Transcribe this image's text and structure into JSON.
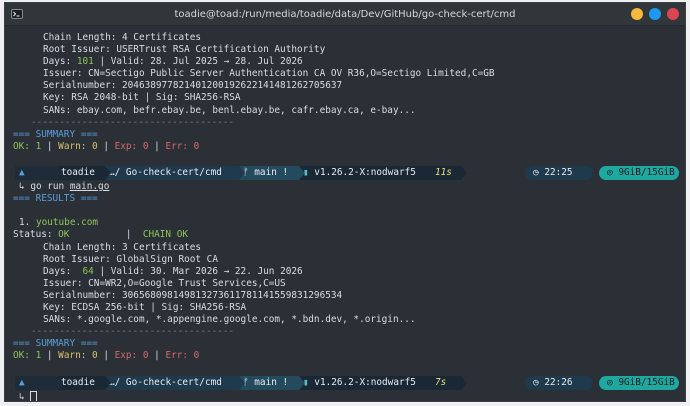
{
  "window": {
    "title": "toadie@toad:/run/media/toadie/data/Dev/GitHub/go-check-cert/cmd",
    "colors": {
      "close": "#da4453",
      "maximize": "#1d99f3",
      "minimize": "#f6b93b"
    }
  },
  "block1": {
    "chain_length": "Chain Length: 4 Certificates",
    "root_issuer": "Root Issuer: USERTrust RSA Certification Authority",
    "days_label": "Days: ",
    "days_value": "101",
    "days_rest": " | Valid: 28. Jul 2025 → 28. Jul 2026",
    "issuer": "Issuer: CN=Sectigo Public Server Authentication CA OV R36,O=Sectigo Limited,C=GB",
    "serial": "Serialnumber: 204638977821401200192622141481262705637",
    "key": "Key: RSA 2048-bit | Sig: SHA256-RSA",
    "sans": "SANs: ebay.com, befr.ebay.be, benl.ebay.be, cafr.ebay.ca, e-bay...",
    "divider": "------------------------------------"
  },
  "summary1": {
    "header": "=== SUMMARY ===",
    "ok": "OK: 1",
    "warn": "Warn: 0",
    "exp": "Exp: 0",
    "err": "Err: 0",
    "sep": " | "
  },
  "prompt1": {
    "user": "toadie",
    "path": "…/ Go-check-cert/cmd",
    "git": " main !",
    "version": " v1.26.2-X:nodwarf5",
    "duration": "11s",
    "clock": "22:25",
    "memory": "9GiB/15GiB"
  },
  "command": {
    "arrow": "↳",
    "text_prefix": "go run ",
    "text_file": "main.go"
  },
  "results_header": "=== RESULTS ===",
  "result": {
    "index": "1.",
    "host": "youtube.com",
    "status_label": "Status: ",
    "status_value": "OK",
    "chain_label": "CHAIN OK",
    "chain_sep": "|",
    "chain_length": "Chain Length: 3 Certificates",
    "root_issuer": "Root Issuer: GlobalSign Root CA",
    "days_label": "Days:  ",
    "days_value": "64",
    "days_rest": " | Valid: 30. Mar 2026 → 22. Jun 2026",
    "issuer": "Issuer: CN=WR2,O=Google Trust Services,C=US",
    "serial": "Serialnumber: 30656809814981327361178114155983129653­4",
    "key": "Key: ECDSA 256-bit | Sig: SHA256-RSA",
    "sans": "SANs: *.google.com, *.appengine.google.com, *.bdn.dev, *.origin...",
    "divider": "------------------------------------"
  },
  "summary2": {
    "header": "=== SUMMARY ===",
    "ok": "OK: 1",
    "warn": "Warn: 0",
    "exp": "Exp: 0",
    "err": "Err: 0",
    "sep": " | "
  },
  "prompt2": {
    "user": "toadie",
    "path": "…/ Go-check-cert/cmd",
    "git": " main !",
    "version": " v1.26.2-X:nodwarf5",
    "duration": "7s",
    "clock": "22:26",
    "memory": "9GiB/15GiB"
  },
  "icons": {
    "os": "arch-linux-icon",
    "folder": "folder-icon",
    "branch": "git-branch-icon",
    "go": "go-version-icon",
    "clock": "clock-icon",
    "memory": "memory-icon"
  }
}
